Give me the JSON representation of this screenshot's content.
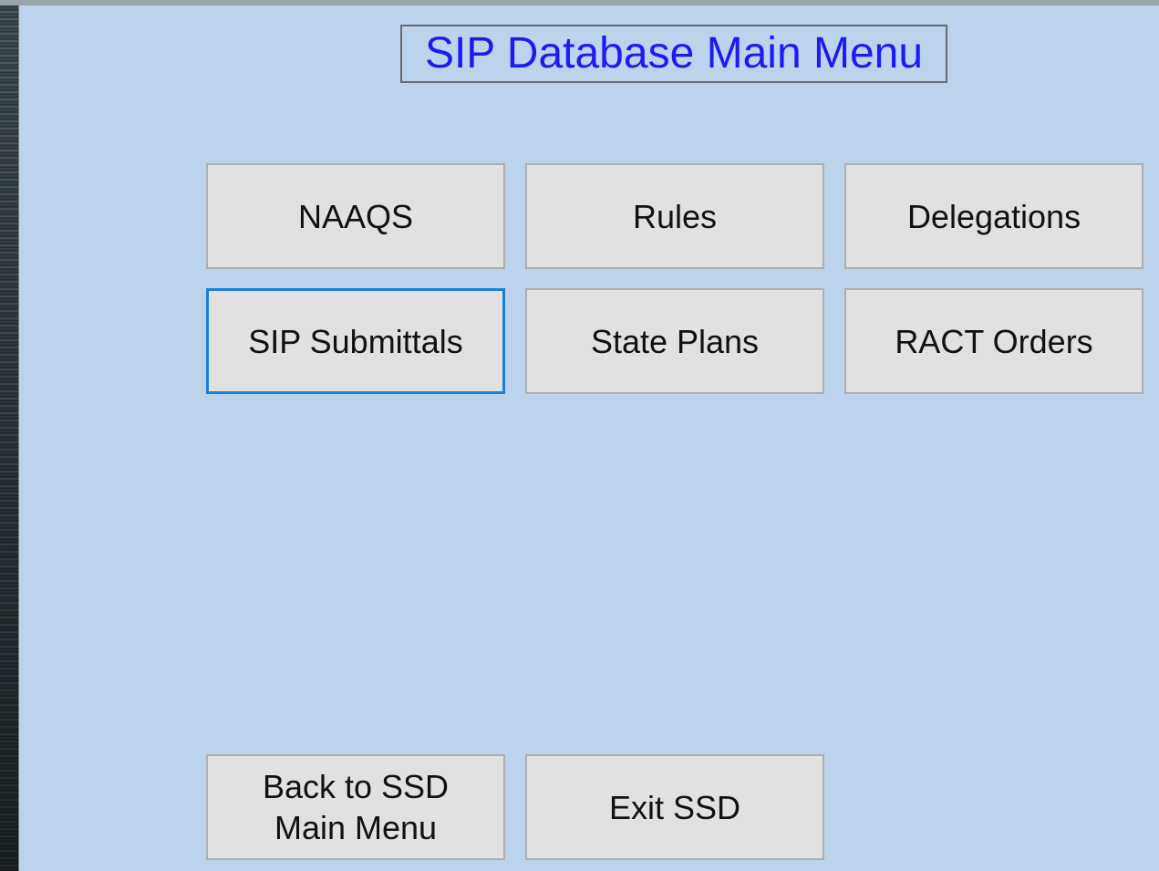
{
  "title": "SIP Database Main Menu",
  "menu": {
    "naaqs": "NAAQS",
    "rules": "Rules",
    "delegations": "Delegations",
    "sip_submittals": "SIP Submittals",
    "state_plans": "State Plans",
    "ract_orders": "RACT Orders"
  },
  "footer": {
    "back_line1": "Back to SSD",
    "back_line2": "Main Menu",
    "exit": "Exit SSD"
  },
  "colors": {
    "form_background": "#bcd3eb",
    "title_text": "#1c1cf0",
    "button_face": "#e1e1e1",
    "focus_border": "#1a7fd9"
  }
}
